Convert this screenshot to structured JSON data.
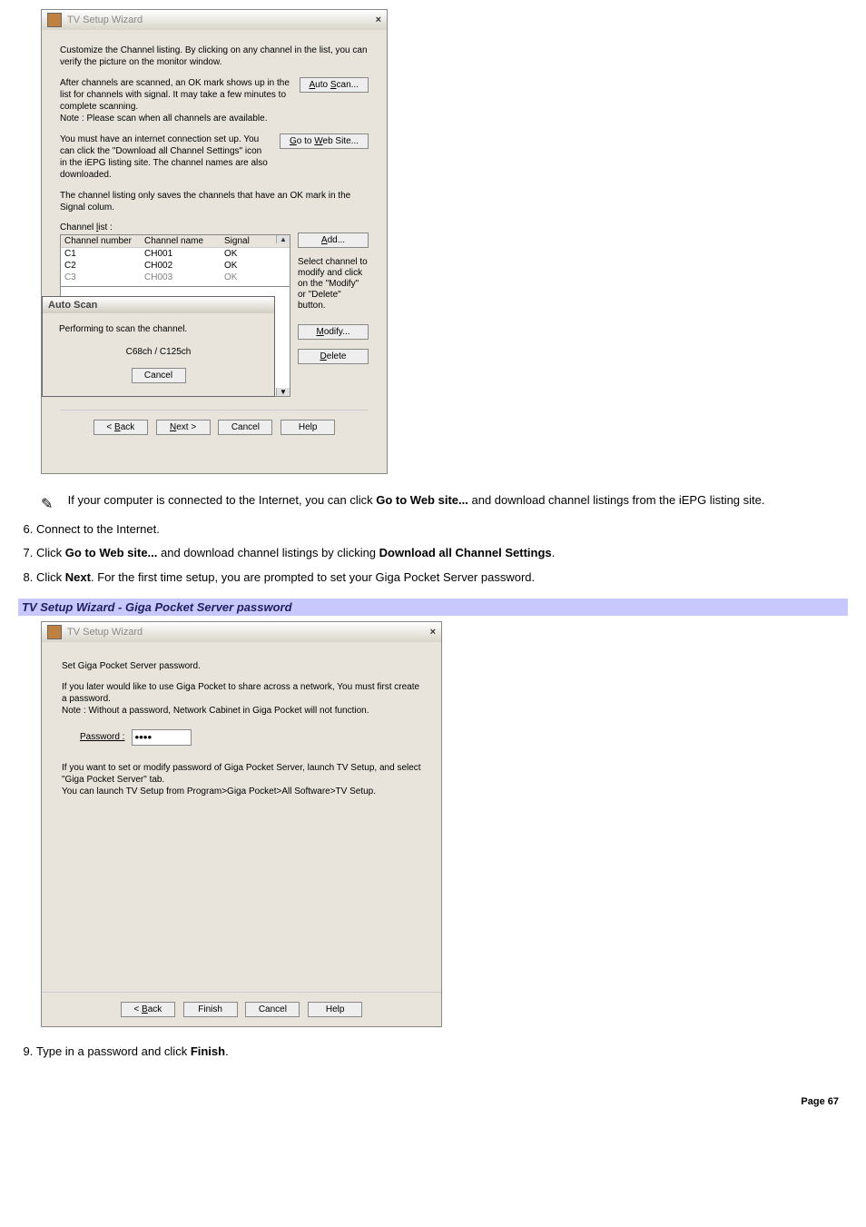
{
  "dialog1": {
    "title": "TV Setup Wizard",
    "close": "×",
    "intro": "Customize the Channel listing. By clicking on any channel in the list, you can verify the picture on the monitor window.",
    "autoscan_text": "After channels are scanned, an OK mark shows up in the list for channels with signal. It may take a few minutes to complete scanning.\nNote : Please scan when all channels are available.",
    "autoscan_btn": "Auto Scan...",
    "web_text": "You must have an internet connection set up. You can click the \"Download all Channel Settings\" icon in the iEPG listing site. The channel names are also downloaded.",
    "web_btn": "Go to Web Site...",
    "save_note": "The channel listing only saves the channels that have an OK mark in the Signal colum.",
    "channel_list_label": "Channel list :",
    "headers": {
      "num": "Channel number",
      "name": "Channel name",
      "signal": "Signal"
    },
    "rows": [
      {
        "num": "C1",
        "name": "CH001",
        "signal": "OK"
      },
      {
        "num": "C2",
        "name": "CH002",
        "signal": "OK"
      },
      {
        "num": "C3",
        "name": "CH003",
        "signal": "OK"
      }
    ],
    "add_btn": "Add...",
    "hint": "Select channel to modify and click on the \"Modify\" or \"Delete\" button.",
    "modify_btn": "Modify...",
    "delete_btn": "Delete",
    "overlay": {
      "title": "Auto Scan",
      "line1": "Performing to scan the channel.",
      "line2": "C68ch / C125ch",
      "cancel": "Cancel"
    },
    "foot": {
      "back": "< Back",
      "next": "Next >",
      "cancel": "Cancel",
      "help": "Help"
    }
  },
  "body": {
    "note_prefix": "If your computer is connected to the Internet, you can click ",
    "note_bold": "Go to Web site...",
    "note_suffix": " and download channel listings from the iEPG listing site.",
    "step6": "Connect to the Internet.",
    "step7_a": "Click ",
    "step7_b": "Go to Web site...",
    "step7_c": " and download channel listings by clicking ",
    "step7_d": "Download all Channel Settings",
    "step7_e": ".",
    "step8_a": "Click ",
    "step8_b": "Next",
    "step8_c": ". For the first time setup, you are prompted to set your Giga Pocket Server password.",
    "section_head": "TV Setup Wizard - Giga Pocket Server password",
    "step9_a": "Type in a password and click ",
    "step9_b": "Finish",
    "step9_c": "."
  },
  "dialog2": {
    "title": "TV Setup Wizard",
    "close": "×",
    "line1": "Set Giga Pocket Server password.",
    "line2": "If you later would like to use Giga Pocket to share across a network, You must first create a password.\nNote : Without a password, Network Cabinet in Giga Pocket will not function.",
    "pw_label": "Password :",
    "pw_value": "xxxx",
    "line3": "If you want to set or modify password of Giga Pocket Server, launch TV Setup, and select \"Giga Pocket Server\" tab.\nYou can launch TV Setup from Program>Giga Pocket>All Software>TV Setup.",
    "foot": {
      "back": "< Back",
      "finish": "Finish",
      "cancel": "Cancel",
      "help": "Help"
    }
  },
  "page_number": "Page 67"
}
